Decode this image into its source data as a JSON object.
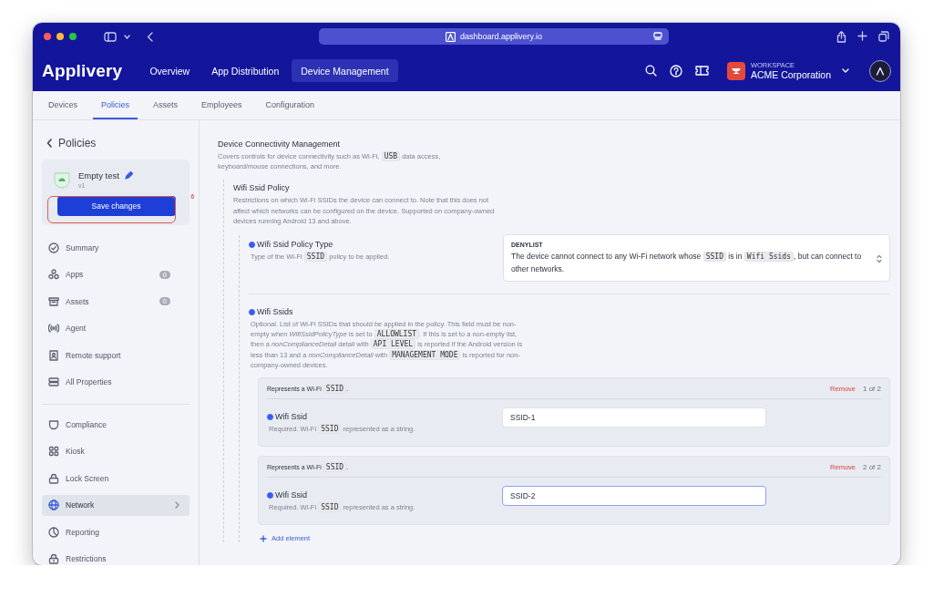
{
  "browser": {
    "url": "dashboard.applivery.io"
  },
  "header": {
    "logo": "Applivery",
    "nav": [
      {
        "label": "Overview",
        "selected": false
      },
      {
        "label": "App Distribution",
        "selected": false
      },
      {
        "label": "Device Management",
        "selected": true
      }
    ],
    "workspace": {
      "caption": "WORKSPACE",
      "name": "ACME Corporation"
    }
  },
  "tabs": [
    {
      "label": "Devices",
      "selected": false
    },
    {
      "label": "Policies",
      "selected": true
    },
    {
      "label": "Assets",
      "selected": false
    },
    {
      "label": "Employees",
      "selected": false
    },
    {
      "label": "Configuration",
      "selected": false
    }
  ],
  "sidebar": {
    "back": "Policies",
    "policy": {
      "name": "Empty test",
      "version": "v1"
    },
    "save_button": "Save changes",
    "annotation": "6",
    "groups": [
      [
        {
          "label": "Summary",
          "selected": false
        },
        {
          "label": "Apps",
          "count": "0",
          "selected": false
        },
        {
          "label": "Assets",
          "count": "0",
          "selected": false
        },
        {
          "label": "Agent",
          "selected": false
        },
        {
          "label": "Remote support",
          "selected": false
        },
        {
          "label": "All Properties",
          "selected": false
        }
      ],
      [
        {
          "label": "Compliance",
          "selected": false
        },
        {
          "label": "Kiosk",
          "selected": false
        },
        {
          "label": "Lock Screen",
          "selected": false
        },
        {
          "label": "Network",
          "selected": true
        },
        {
          "label": "Reporting",
          "selected": false
        },
        {
          "label": "Restrictions",
          "selected": false
        }
      ]
    ]
  },
  "section": {
    "title": "Device Connectivity Management",
    "description": [
      {
        "kind": "text",
        "text": "Covers controls for device connectivity such as Wi-Fi, "
      },
      {
        "kind": "code",
        "text": "USB"
      },
      {
        "kind": "text",
        "text": " data access, keyboard/mouse connections, and more."
      }
    ],
    "subsection": {
      "title": "Wifi Ssid Policy",
      "description": [
        {
          "kind": "text",
          "text": "Restrictions on which Wi-Fi SSIDs the device can connect to. Note that this does not affect which networks can be configured on the device. Supported on company-owned devices running Android 13 and above."
        }
      ],
      "policy_type": {
        "label": "Wifi Ssid Policy Type",
        "set": true,
        "description": [
          {
            "kind": "text",
            "text": "Type of the Wi-Fi "
          },
          {
            "kind": "code",
            "text": "SSID"
          },
          {
            "kind": "text",
            "text": " policy to be applied."
          }
        ],
        "select": {
          "title": "DENYLIST",
          "description": [
            {
              "kind": "text",
              "text": "The device cannot connect to any Wi-Fi network whose "
            },
            {
              "kind": "code",
              "text": "SSID"
            },
            {
              "kind": "text",
              "text": " is in "
            },
            {
              "kind": "code",
              "text": "Wifi Ssids"
            },
            {
              "kind": "text",
              "text": ", but can connect to other networks."
            }
          ]
        }
      },
      "ssids": {
        "label": "Wifi Ssids",
        "set": true,
        "description": [
          {
            "kind": "text",
            "text": "Optional. List of Wi-Fi SSIDs that should be applied in the policy. This field must be non-empty when "
          },
          {
            "kind": "em",
            "text": "WifiSsidPolicyType"
          },
          {
            "kind": "text",
            "text": " is set to "
          },
          {
            "kind": "code",
            "text": "ALLOWLIST"
          },
          {
            "kind": "text",
            "text": ". If this is set to a non-empty list, then a "
          },
          {
            "kind": "em",
            "text": "nonComplianceDetail"
          },
          {
            "kind": "text",
            "text": " detail with "
          },
          {
            "kind": "code",
            "text": "API LEVEL"
          },
          {
            "kind": "text",
            "text": " is reported if the Android version is less than 13 and a "
          },
          {
            "kind": "em",
            "text": "nonComplianceDetail"
          },
          {
            "kind": "text",
            "text": " with "
          },
          {
            "kind": "code",
            "text": "MANAGEMENT MODE"
          },
          {
            "kind": "text",
            "text": " is reported for non-company-owned devices."
          }
        ],
        "items": [
          {
            "header": [
              {
                "kind": "text",
                "text": "Represents a Wi-Fi "
              },
              {
                "kind": "code",
                "text": "SSID"
              },
              {
                "kind": "text",
                "text": "."
              }
            ],
            "remove": "Remove",
            "counter": "1 of 2",
            "label": "Wifi Ssid",
            "set": true,
            "description": [
              {
                "kind": "text",
                "text": "Required. Wi-Fi "
              },
              {
                "kind": "code",
                "text": "SSID"
              },
              {
                "kind": "text",
                "text": " represented as a string."
              }
            ],
            "value": "SSID-1",
            "focused": false
          },
          {
            "header": [
              {
                "kind": "text",
                "text": "Represents a Wi-Fi "
              },
              {
                "kind": "code",
                "text": "SSID"
              },
              {
                "kind": "text",
                "text": "."
              }
            ],
            "remove": "Remove",
            "counter": "2 of 2",
            "label": "Wifi Ssid",
            "set": true,
            "description": [
              {
                "kind": "text",
                "text": "Required. Wi-Fi "
              },
              {
                "kind": "code",
                "text": "SSID"
              },
              {
                "kind": "text",
                "text": " represented as a string."
              }
            ],
            "value": "SSID-2",
            "focused": true
          }
        ],
        "add": "Add element"
      }
    }
  }
}
